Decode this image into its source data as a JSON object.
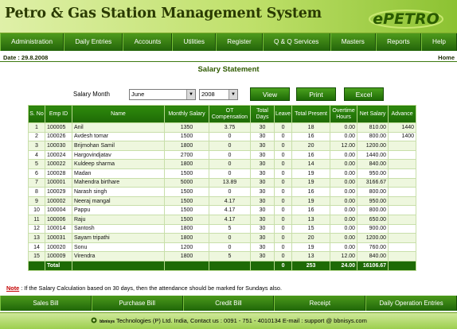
{
  "app": {
    "title": "Petro & Gas Station Management System",
    "logo_text": "ePETRO"
  },
  "nav": {
    "items": [
      "Administration",
      "Daily Entries",
      "Accounts",
      "Utilities",
      "Register",
      "Q & Q Services",
      "Masters",
      "Reports",
      "Help"
    ]
  },
  "info": {
    "date": "Date : 29.8.2008",
    "home": "Home"
  },
  "page": {
    "title": "Salary Statement"
  },
  "filters": {
    "month_label": "Salary Month",
    "month_value": "June",
    "year_value": "2008",
    "view_label": "View",
    "print_label": "Print",
    "excel_label": "Excel"
  },
  "table": {
    "headers": [
      "S. No",
      "Emp ID",
      "Name",
      "Monthly Salary",
      "OT Compensation",
      "Total Days",
      "Leave",
      "Total Present",
      "Overtime Hours",
      "Net Salary",
      "Advance"
    ],
    "rows": [
      [
        "1",
        "100005",
        "Anil",
        "1350",
        "3.75",
        "30",
        "0",
        "18",
        "0.00",
        "810.00",
        "1440"
      ],
      [
        "2",
        "100026",
        "Avdesh tomar",
        "1500",
        "0",
        "30",
        "0",
        "16",
        "0.00",
        "800.00",
        "1400"
      ],
      [
        "3",
        "100030",
        "Brijmohan Samil",
        "1800",
        "0",
        "30",
        "0",
        "20",
        "12.00",
        "1200.00",
        ""
      ],
      [
        "4",
        "100024",
        "Hargovindjatav",
        "2700",
        "0",
        "30",
        "0",
        "16",
        "0.00",
        "1440.00",
        ""
      ],
      [
        "5",
        "100022",
        "Kuldeep sharma",
        "1800",
        "0",
        "30",
        "0",
        "14",
        "0.00",
        "840.00",
        ""
      ],
      [
        "6",
        "100028",
        "Madan",
        "1500",
        "0",
        "30",
        "0",
        "19",
        "0.00",
        "950.00",
        ""
      ],
      [
        "7",
        "100001",
        "Mahendra birthare",
        "5000",
        "13.89",
        "30",
        "0",
        "19",
        "0.00",
        "3166.67",
        ""
      ],
      [
        "8",
        "100029",
        "Narash singh",
        "1500",
        "0",
        "30",
        "0",
        "16",
        "0.00",
        "800.00",
        ""
      ],
      [
        "9",
        "100002",
        "Neeraj mangal",
        "1500",
        "4.17",
        "30",
        "0",
        "19",
        "0.00",
        "950.00",
        ""
      ],
      [
        "10",
        "100004",
        "Pappu",
        "1500",
        "4.17",
        "30",
        "0",
        "16",
        "0.00",
        "800.00",
        ""
      ],
      [
        "11",
        "100006",
        "Raju",
        "1500",
        "4.17",
        "30",
        "0",
        "13",
        "0.00",
        "650.00",
        ""
      ],
      [
        "12",
        "100014",
        "Santosh",
        "1800",
        "5",
        "30",
        "0",
        "15",
        "0.00",
        "900.00",
        ""
      ],
      [
        "13",
        "100031",
        "Sayam tripathi",
        "1800",
        "0",
        "30",
        "0",
        "20",
        "0.00",
        "1200.00",
        ""
      ],
      [
        "14",
        "100020",
        "Sonu",
        "1200",
        "0",
        "30",
        "0",
        "19",
        "0.00",
        "760.00",
        ""
      ],
      [
        "15",
        "100009",
        "Virendra",
        "1800",
        "5",
        "30",
        "0",
        "13",
        "12.00",
        "840.00",
        ""
      ]
    ],
    "total": {
      "label": "Total",
      "leave": "0",
      "present": "253",
      "overtime": "24.00",
      "net": "16106.67"
    }
  },
  "note": {
    "label": "Note",
    "text": " : If the Salary Calculation based on 30 days, then the attendance should be marked for Sundays also."
  },
  "bottom_nav": {
    "items": [
      "Sales Bill",
      "Purchase Bill",
      "Credit Bill",
      "Receipt",
      "Daily Operation Entries"
    ]
  },
  "footer": {
    "text": "Technologies (P) Ltd. India, Contact us : 0091 - 751 - 4010134 E-mail : support @ bbnisys.com",
    "brand": "bbnisys"
  },
  "colors": {
    "header_bg": "#bfe06a",
    "nav_bg": "#2e7a0e",
    "accent": "#1e6a06",
    "note_label": "#c40000"
  }
}
